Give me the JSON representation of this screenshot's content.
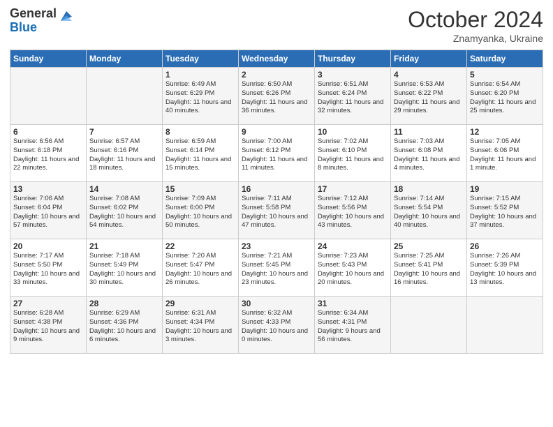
{
  "logo": {
    "general": "General",
    "blue": "Blue"
  },
  "header": {
    "month": "October 2024",
    "location": "Znamyanka, Ukraine"
  },
  "days_of_week": [
    "Sunday",
    "Monday",
    "Tuesday",
    "Wednesday",
    "Thursday",
    "Friday",
    "Saturday"
  ],
  "weeks": [
    [
      {
        "day": "",
        "info": ""
      },
      {
        "day": "",
        "info": ""
      },
      {
        "day": "1",
        "info": "Sunrise: 6:49 AM\nSunset: 6:29 PM\nDaylight: 11 hours and 40 minutes."
      },
      {
        "day": "2",
        "info": "Sunrise: 6:50 AM\nSunset: 6:26 PM\nDaylight: 11 hours and 36 minutes."
      },
      {
        "day": "3",
        "info": "Sunrise: 6:51 AM\nSunset: 6:24 PM\nDaylight: 11 hours and 32 minutes."
      },
      {
        "day": "4",
        "info": "Sunrise: 6:53 AM\nSunset: 6:22 PM\nDaylight: 11 hours and 29 minutes."
      },
      {
        "day": "5",
        "info": "Sunrise: 6:54 AM\nSunset: 6:20 PM\nDaylight: 11 hours and 25 minutes."
      }
    ],
    [
      {
        "day": "6",
        "info": "Sunrise: 6:56 AM\nSunset: 6:18 PM\nDaylight: 11 hours and 22 minutes."
      },
      {
        "day": "7",
        "info": "Sunrise: 6:57 AM\nSunset: 6:16 PM\nDaylight: 11 hours and 18 minutes."
      },
      {
        "day": "8",
        "info": "Sunrise: 6:59 AM\nSunset: 6:14 PM\nDaylight: 11 hours and 15 minutes."
      },
      {
        "day": "9",
        "info": "Sunrise: 7:00 AM\nSunset: 6:12 PM\nDaylight: 11 hours and 11 minutes."
      },
      {
        "day": "10",
        "info": "Sunrise: 7:02 AM\nSunset: 6:10 PM\nDaylight: 11 hours and 8 minutes."
      },
      {
        "day": "11",
        "info": "Sunrise: 7:03 AM\nSunset: 6:08 PM\nDaylight: 11 hours and 4 minutes."
      },
      {
        "day": "12",
        "info": "Sunrise: 7:05 AM\nSunset: 6:06 PM\nDaylight: 11 hours and 1 minute."
      }
    ],
    [
      {
        "day": "13",
        "info": "Sunrise: 7:06 AM\nSunset: 6:04 PM\nDaylight: 10 hours and 57 minutes."
      },
      {
        "day": "14",
        "info": "Sunrise: 7:08 AM\nSunset: 6:02 PM\nDaylight: 10 hours and 54 minutes."
      },
      {
        "day": "15",
        "info": "Sunrise: 7:09 AM\nSunset: 6:00 PM\nDaylight: 10 hours and 50 minutes."
      },
      {
        "day": "16",
        "info": "Sunrise: 7:11 AM\nSunset: 5:58 PM\nDaylight: 10 hours and 47 minutes."
      },
      {
        "day": "17",
        "info": "Sunrise: 7:12 AM\nSunset: 5:56 PM\nDaylight: 10 hours and 43 minutes."
      },
      {
        "day": "18",
        "info": "Sunrise: 7:14 AM\nSunset: 5:54 PM\nDaylight: 10 hours and 40 minutes."
      },
      {
        "day": "19",
        "info": "Sunrise: 7:15 AM\nSunset: 5:52 PM\nDaylight: 10 hours and 37 minutes."
      }
    ],
    [
      {
        "day": "20",
        "info": "Sunrise: 7:17 AM\nSunset: 5:50 PM\nDaylight: 10 hours and 33 minutes."
      },
      {
        "day": "21",
        "info": "Sunrise: 7:18 AM\nSunset: 5:49 PM\nDaylight: 10 hours and 30 minutes."
      },
      {
        "day": "22",
        "info": "Sunrise: 7:20 AM\nSunset: 5:47 PM\nDaylight: 10 hours and 26 minutes."
      },
      {
        "day": "23",
        "info": "Sunrise: 7:21 AM\nSunset: 5:45 PM\nDaylight: 10 hours and 23 minutes."
      },
      {
        "day": "24",
        "info": "Sunrise: 7:23 AM\nSunset: 5:43 PM\nDaylight: 10 hours and 20 minutes."
      },
      {
        "day": "25",
        "info": "Sunrise: 7:25 AM\nSunset: 5:41 PM\nDaylight: 10 hours and 16 minutes."
      },
      {
        "day": "26",
        "info": "Sunrise: 7:26 AM\nSunset: 5:39 PM\nDaylight: 10 hours and 13 minutes."
      }
    ],
    [
      {
        "day": "27",
        "info": "Sunrise: 6:28 AM\nSunset: 4:38 PM\nDaylight: 10 hours and 9 minutes."
      },
      {
        "day": "28",
        "info": "Sunrise: 6:29 AM\nSunset: 4:36 PM\nDaylight: 10 hours and 6 minutes."
      },
      {
        "day": "29",
        "info": "Sunrise: 6:31 AM\nSunset: 4:34 PM\nDaylight: 10 hours and 3 minutes."
      },
      {
        "day": "30",
        "info": "Sunrise: 6:32 AM\nSunset: 4:33 PM\nDaylight: 10 hours and 0 minutes."
      },
      {
        "day": "31",
        "info": "Sunrise: 6:34 AM\nSunset: 4:31 PM\nDaylight: 9 hours and 56 minutes."
      },
      {
        "day": "",
        "info": ""
      },
      {
        "day": "",
        "info": ""
      }
    ]
  ]
}
